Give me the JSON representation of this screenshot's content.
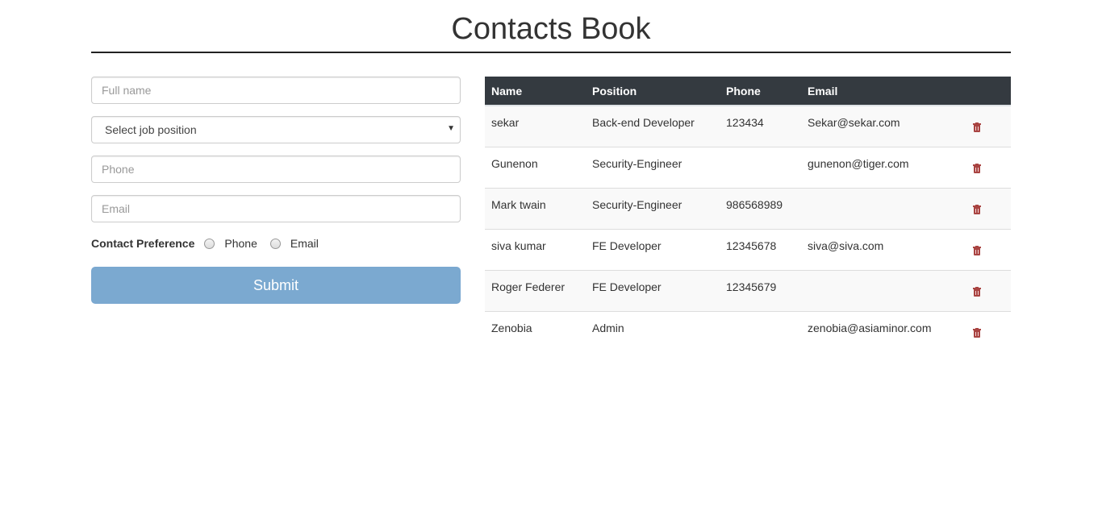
{
  "page": {
    "title": "Contacts Book"
  },
  "form": {
    "fullname_placeholder": "Full name",
    "position_select": {
      "selected": "Select job position"
    },
    "phone_placeholder": "Phone",
    "email_placeholder": "Email",
    "contact_preference": {
      "label": "Contact Preference",
      "options": [
        "Phone",
        "Email"
      ]
    },
    "submit_label": "Submit"
  },
  "table": {
    "headers": [
      "Name",
      "Position",
      "Phone",
      "Email",
      ""
    ],
    "rows": [
      {
        "name": "sekar",
        "position": "Back-end Developer",
        "phone": "123434",
        "email": "Sekar@sekar.com"
      },
      {
        "name": "Gunenon",
        "position": "Security-Engineer",
        "phone": "",
        "email": "gunenon@tiger.com"
      },
      {
        "name": "Mark twain",
        "position": "Security-Engineer",
        "phone": "986568989",
        "email": ""
      },
      {
        "name": "siva kumar",
        "position": "FE Developer",
        "phone": "12345678",
        "email": "siva@siva.com"
      },
      {
        "name": "Roger Federer",
        "position": "FE Developer",
        "phone": "12345679",
        "email": ""
      },
      {
        "name": "Zenobia",
        "position": "Admin",
        "phone": "",
        "email": "zenobia@asiaminor.com"
      }
    ],
    "delete_icon": "trash-icon"
  },
  "colors": {
    "header_bg": "#343a40",
    "submit_bg": "#7ba9d0",
    "delete_icon": "#a94442",
    "stripe": "#f9f9f9"
  }
}
